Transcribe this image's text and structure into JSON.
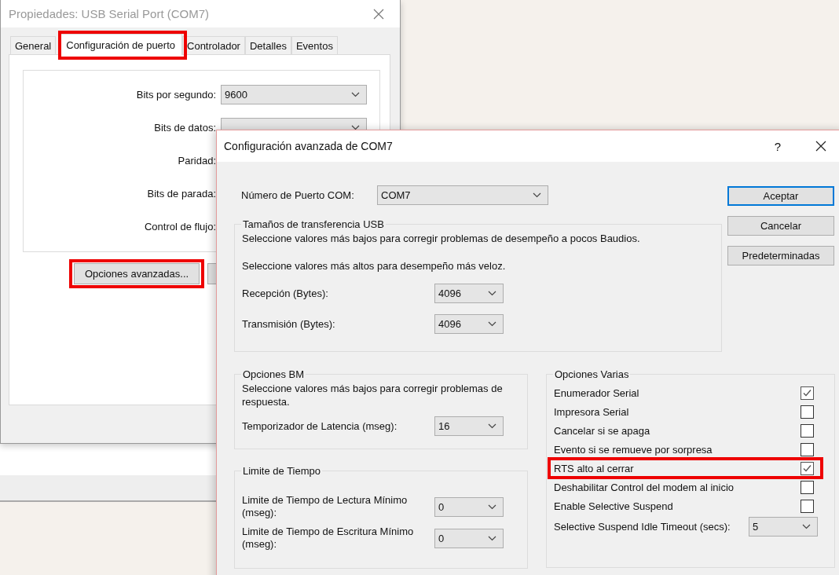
{
  "back_window": {
    "title": "Propiedades: USB Serial Port (COM7)",
    "tabs": [
      {
        "label": "General",
        "selected": false,
        "highlighted": false
      },
      {
        "label": "Configuración de puerto",
        "selected": true,
        "highlighted": true
      },
      {
        "label": "Controlador",
        "selected": false,
        "highlighted": false
      },
      {
        "label": "Detalles",
        "selected": false,
        "highlighted": false
      },
      {
        "label": "Eventos",
        "selected": false,
        "highlighted": false
      }
    ],
    "fields": [
      {
        "label": "Bits por segundo:",
        "kind": "dropdown",
        "value": "9600"
      },
      {
        "label": "Bits de datos:",
        "kind": "dropdown"
      },
      {
        "label": "Paridad:",
        "kind": "label"
      },
      {
        "label": "Bits de parada:",
        "kind": "label"
      },
      {
        "label": "Control de flujo:",
        "kind": "label"
      }
    ],
    "advanced_button": {
      "label": "Opciones avanzadas...",
      "highlighted": true
    }
  },
  "dialog": {
    "title": "Configuración avanzada de COM7",
    "help": "?",
    "com_port": {
      "label": "Número de Puerto COM:",
      "value": "COM7"
    },
    "usb_group": {
      "title": "Tamaños de transferencia USB",
      "notes": [
        "Seleccione valores más bajos para corregir problemas de desempeño a pocos Baudios.",
        "Seleccione valores más altos para desempeño más veloz."
      ],
      "fields": [
        {
          "label": "Recepción (Bytes):",
          "value": "4096"
        },
        {
          "label": "Transmisión (Bytes):",
          "value": "4096"
        }
      ]
    },
    "bm_group": {
      "title": "Opciones BM",
      "note": "Seleccione valores más bajos para corregir problemas de respuesta.",
      "fields": [
        {
          "label": "Temporizador de Latencia (mseg):",
          "value": "16"
        }
      ]
    },
    "timeout_group": {
      "title": "Limite de Tiempo",
      "fields": [
        {
          "label": "Limite de Tiempo de Lectura Mínimo (mseg):",
          "value": "0"
        },
        {
          "label": "Limite de Tiempo de Escritura Mínimo (mseg):",
          "value": "0"
        }
      ]
    },
    "misc_group": {
      "title": "Opciones Varias",
      "options": [
        {
          "label": "Enumerador Serial",
          "checked": true,
          "highlighted": false
        },
        {
          "label": "Impresora Serial",
          "checked": false,
          "highlighted": false
        },
        {
          "label": "Cancelar si se apaga",
          "checked": false,
          "highlighted": false
        },
        {
          "label": "Evento si se remueve por sorpresa",
          "checked": false,
          "highlighted": false
        },
        {
          "label": "RTS alto al cerrar",
          "checked": true,
          "highlighted": true
        },
        {
          "label": "Deshabilitar Control del modem al inicio",
          "checked": false,
          "highlighted": false
        },
        {
          "label": "Enable Selective Suspend",
          "checked": false,
          "highlighted": false
        }
      ],
      "fields": [
        {
          "label": "Selective Suspend Idle Timeout (secs):",
          "value": "5"
        }
      ]
    },
    "buttons": [
      {
        "label": "Aceptar",
        "default": true
      },
      {
        "label": "Cancelar",
        "default": false
      },
      {
        "label": "Predeterminadas",
        "default": false
      }
    ]
  }
}
